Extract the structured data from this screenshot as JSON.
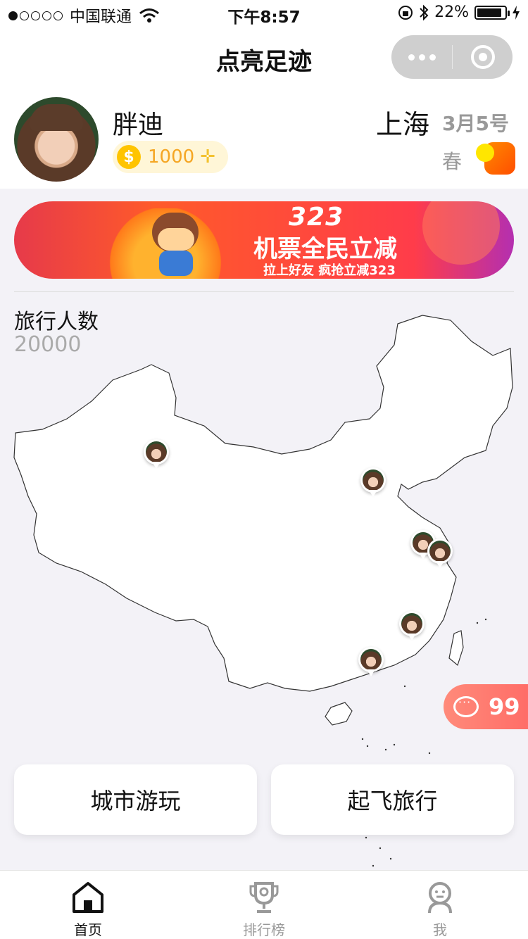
{
  "status_bar": {
    "carrier": "中国联通",
    "time": "下午8:57",
    "battery": "22%"
  },
  "nav": {
    "title": "点亮足迹"
  },
  "profile": {
    "name": "胖迪",
    "coins": "1000",
    "city": "上海",
    "date": "3月5号",
    "season": "春"
  },
  "banner": {
    "badge": "323",
    "title": "机票全民立减",
    "subtitle": "拉上好友 疯抢立减323"
  },
  "stats": {
    "label": "旅行人数",
    "value": "20000"
  },
  "map": {
    "icon": "china-map",
    "pins": [
      "xinjiang",
      "beijing-area",
      "nanjing",
      "shanghai",
      "fujian",
      "guangdong"
    ]
  },
  "comments": {
    "count": "99"
  },
  "actions": {
    "city_play": "城市游玩",
    "fly_travel": "起飞旅行"
  },
  "tabbar": {
    "items": [
      {
        "label": "首页",
        "icon": "home-icon",
        "active": true
      },
      {
        "label": "排行榜",
        "icon": "trophy-icon",
        "active": false
      },
      {
        "label": "我",
        "icon": "user-icon",
        "active": false
      }
    ]
  },
  "colors": {
    "coin": "#ffc400",
    "coin_text": "#f5a623",
    "comments_bg": "#ff6b66",
    "season_accent": "#ff6a00"
  }
}
